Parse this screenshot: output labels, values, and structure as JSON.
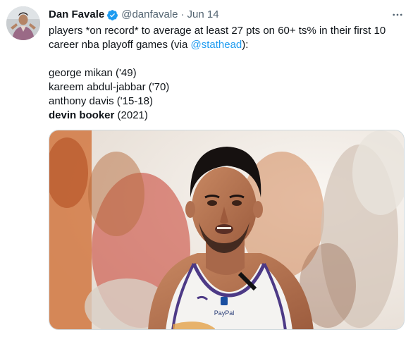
{
  "tweet": {
    "author_name": "Dan Favale",
    "handle": "@danfavale",
    "separator": "·",
    "date": "Jun 14",
    "more_label": "···",
    "text_line_prefix": "players *on record* to average at least 27 pts on 60+ ts% in their first 10 career nba playoff games (via ",
    "mention": "@stathead",
    "text_line_suffix": "):",
    "list": [
      {
        "name": "george mikan",
        "years": " ('49)"
      },
      {
        "name": "kareem abdul-jabbar",
        "years": " ('70)"
      },
      {
        "name": "anthony davis",
        "years": " ('15-18)"
      },
      {
        "name": "devin booker",
        "years": " (2021)"
      }
    ],
    "jersey_brand": "PayPal"
  },
  "colors": {
    "link": "#1d9bf0",
    "verified": "#1d9bf0",
    "secondary_text": "#536471",
    "primary_text": "#0f1419"
  },
  "icons": {
    "verified": "verified-badge-icon",
    "more": "more-horizontal-icon"
  }
}
